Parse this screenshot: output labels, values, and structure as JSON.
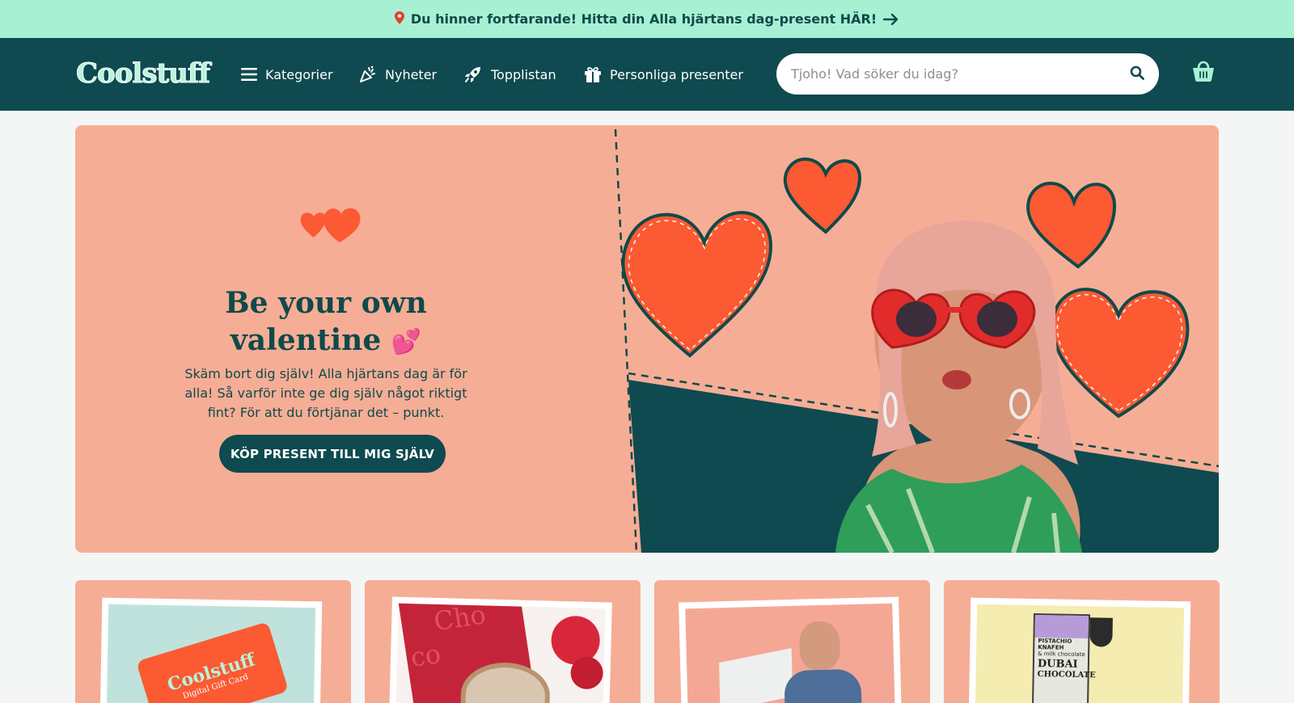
{
  "announcement": {
    "text": "Du hinner fortfarande! Hitta din Alla hjärtans dag-present HÄR!",
    "pin_icon": "pin-icon",
    "arrow_icon": "arrow-right-icon"
  },
  "header": {
    "logo": "Coolstuff",
    "nav": [
      {
        "label": "Kategorier",
        "icon": "menu-icon"
      },
      {
        "label": "Nyheter",
        "icon": "party-popper-icon"
      },
      {
        "label": "Topplistan",
        "icon": "rocket-icon"
      },
      {
        "label": "Personliga presenter",
        "icon": "gift-icon"
      }
    ],
    "search": {
      "placeholder": "Tjoho! Vad söker du idag?",
      "value": ""
    },
    "cart_icon": "shopping-basket-icon"
  },
  "hero": {
    "title_line1": "Be your own",
    "title_line2": "valentine",
    "title_emoji": "💕",
    "text": "Skäm bort dig själv! Alla hjärtans dag är för alla! Så varför inte ge dig själv något riktigt fint? För att du förtjänar det – punkt.",
    "button": "KÖP PRESENT TILL MIG SJÄLV"
  },
  "cards": [
    {
      "logo_text": "Coolstuff",
      "sub_text": "Digital Gift Card"
    },
    {
      "title_text": "Cho",
      "sub_text": "co"
    },
    {},
    {
      "brand_line1": "PISTACHIO",
      "brand_line2": "KNAFEH",
      "brand_line3": "& milk chocolate",
      "name_line1": "DUBAI",
      "name_line2": "CHOCOLATE"
    }
  ],
  "colors": {
    "announce_bg": "#a8f0d4",
    "header_bg": "#0e4a4f",
    "hero_bg": "#f6ad96",
    "heart": "#fb5a33",
    "text_dark": "#0f4a4a"
  }
}
